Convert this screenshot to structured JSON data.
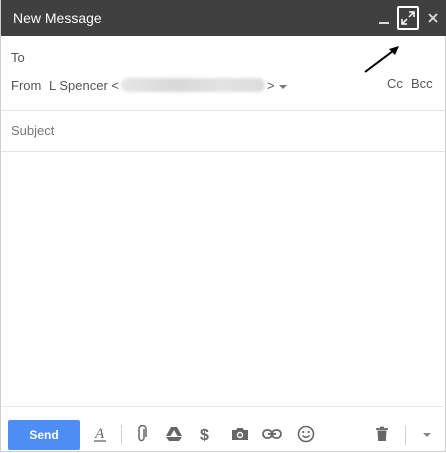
{
  "window": {
    "title": "New Message"
  },
  "titlebar_icons": [
    "minimize-icon",
    "pop-out-icon",
    "close-icon"
  ],
  "to": {
    "label": "To"
  },
  "from": {
    "label": "From",
    "name": "L Spencer <",
    "close_bracket": ">"
  },
  "cc_label": "Cc",
  "bcc_label": "Bcc",
  "subject": {
    "placeholder": "Subject"
  },
  "toolbar": {
    "send_label": "Send",
    "icons": [
      "formatting-icon",
      "attach-icon",
      "drive-icon",
      "money-icon",
      "photo-icon",
      "link-icon",
      "emoji-icon",
      "trash-icon",
      "more-options-icon"
    ]
  },
  "colors": {
    "titlebar": "#404040",
    "send_button": "#4d8ef5"
  }
}
